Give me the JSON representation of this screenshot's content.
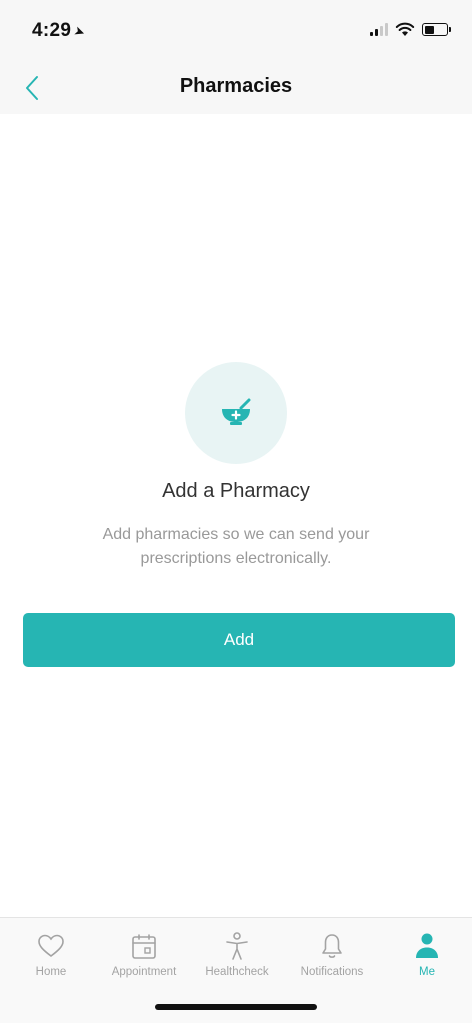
{
  "status_bar": {
    "time": "4:29",
    "location_icon": "location-arrow-icon",
    "signal_icon": "cellular-signal-icon",
    "wifi_icon": "wifi-icon",
    "battery_icon": "battery-icon"
  },
  "nav": {
    "title": "Pharmacies",
    "back_icon": "chevron-left-icon"
  },
  "empty_state": {
    "icon": "mortar-pestle-icon",
    "title": "Add a Pharmacy",
    "description": "Add pharmacies so we can send your prescriptions electronically."
  },
  "actions": {
    "add_label": "Add"
  },
  "tabs": [
    {
      "label": "Home",
      "icon": "heart-icon",
      "active": false
    },
    {
      "label": "Appointment",
      "icon": "calendar-icon",
      "active": false
    },
    {
      "label": "Healthcheck",
      "icon": "person-icon",
      "active": false
    },
    {
      "label": "Notifications",
      "icon": "bell-icon",
      "active": false
    },
    {
      "label": "Me",
      "icon": "user-icon",
      "active": true
    }
  ],
  "colors": {
    "accent": "#26b5b3",
    "icon_circle": "#e8f4f4",
    "inactive": "#a3a3a3",
    "header_bg": "#f7f7f7"
  }
}
